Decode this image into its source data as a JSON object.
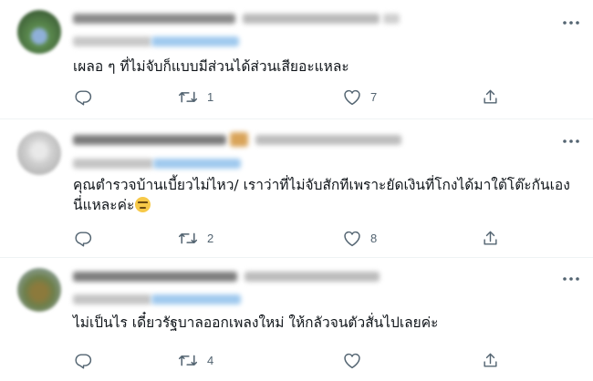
{
  "tweets": [
    {
      "text_lines": [
        "เผลอ ๆ ที่ไม่จับก็แบบมีส่วนได้ส่วนเสียอะแหละ"
      ],
      "replies": "",
      "retweets": "1",
      "likes": "7",
      "avatar_color": "#6f9a6a"
    },
    {
      "text_lines": [
        "คุณตำรวจบ้านเบี้ยวไม่ไหว/ เราว่าที่ไม่จับสักทีเพราะยัดเงินที่โกงได้มาใต้โต๊ะกันเอง",
        "นี่แหละค่ะ"
      ],
      "replies": "",
      "retweets": "2",
      "likes": "8",
      "avatar_color": "#c9c9c9"
    },
    {
      "text_lines": [
        "ไม่เป็นไร เดี๋ยวรัฐบาลออกเพลงใหม่ ให้กลัวจนตัวสั่นไปเลยค่ะ"
      ],
      "replies": "",
      "retweets": "4",
      "likes": "",
      "avatar_color": "#7b8a5a"
    }
  ],
  "icons": {
    "reply": "reply-icon",
    "retweet": "retweet-icon",
    "like": "like-icon",
    "share": "share-icon",
    "more": "more-icon",
    "emoji": "unamused-face-emoji"
  },
  "colors": {
    "text": "#0f1419",
    "muted": "#536471",
    "link_blue": "#1d9bf0",
    "divider": "#eff3f4"
  }
}
